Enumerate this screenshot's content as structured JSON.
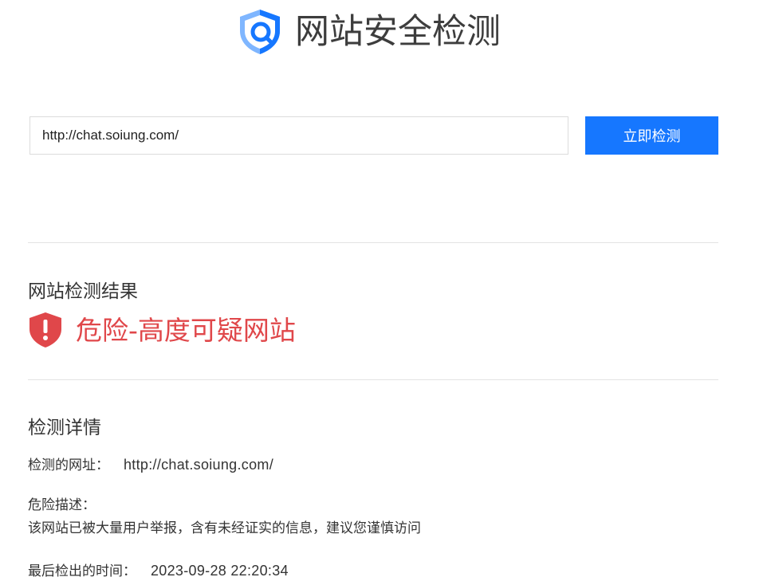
{
  "header": {
    "title": "网站安全检测",
    "logo_icon": "shield-search-icon",
    "colors": {
      "logo_primary": "#1677ff",
      "logo_light": "#7fb6ff"
    }
  },
  "search": {
    "value": "http://chat.soiung.com/",
    "button_label": "立即检测",
    "colors": {
      "button": "#1677ff"
    }
  },
  "result": {
    "section_title": "网站检测结果",
    "status_icon": "danger-shield-icon",
    "status_text": "危险-高度可疑网站",
    "colors": {
      "danger": "#e0474a"
    }
  },
  "details": {
    "section_title": "检测详情",
    "url_label": "检测的网址：",
    "url_value": "http://chat.soiung.com/",
    "desc_label": "危险描述：",
    "desc_text": "该网站已被大量用户举报，含有未经证实的信息，建议您谨慎访问",
    "time_label": "最后检出的时间：",
    "time_value": "2023-09-28 22:20:34"
  }
}
